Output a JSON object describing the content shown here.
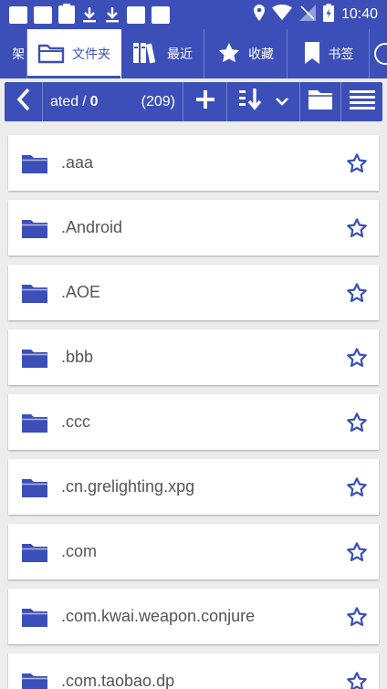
{
  "status_bar": {
    "time": "10:40"
  },
  "tabs": [
    {
      "label": "书架",
      "icon": "bookshelf-icon"
    },
    {
      "label": "文件夹",
      "icon": "folder-icon",
      "active": true
    },
    {
      "label": "最近",
      "icon": "books-icon"
    },
    {
      "label": "收藏",
      "icon": "star-icon"
    },
    {
      "label": "书签",
      "icon": "bookmark-icon"
    }
  ],
  "toolbar": {
    "path_prefix": "ated",
    "path_separator": "/",
    "path_current": "0",
    "item_count": "(209)"
  },
  "folders": [
    {
      "name": ".aaa"
    },
    {
      "name": ".Android"
    },
    {
      "name": ".AOE"
    },
    {
      "name": ".bbb"
    },
    {
      "name": ".ccc"
    },
    {
      "name": ".cn.grelighting.xpg"
    },
    {
      "name": ".com"
    },
    {
      "name": ".com.kwai.weapon.conjure"
    },
    {
      "name": ".com.taobao.dp"
    }
  ],
  "colors": {
    "accent": "#3c4fb8",
    "background": "#ececec",
    "card": "#ffffff",
    "text": "#555555"
  }
}
